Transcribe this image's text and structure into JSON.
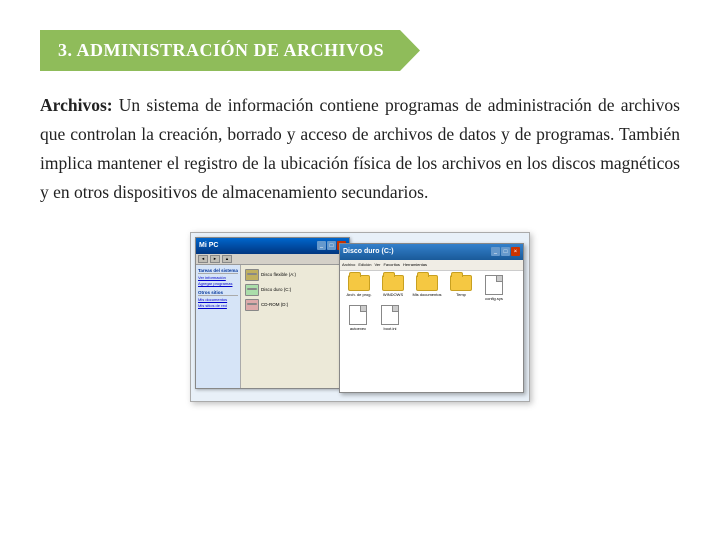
{
  "header": {
    "title": "3.  ADMINISTRACIÓN DE  ARCHIVOS",
    "bg_color": "#8fbc5a"
  },
  "body": {
    "paragraph": {
      "label": "Archivos:",
      "text": "  Un sistema de información contiene programas de administración de archivos que controlan la creación, borrado y acceso de archivos de datos y de programas. También implica mantener el registro de la ubicación física de los archivos en los discos magnéticos y en otros dispositivos de almacenamiento secundarios."
    }
  },
  "screenshot": {
    "left_window": {
      "title": "Mi PC",
      "drives": [
        "Disco flexible (A:)",
        "Disco duro (C:)",
        "CD-ROM (D:)"
      ],
      "sidebar_sections": [
        {
          "title": "Tareas del sistema",
          "items": [
            "Ver información del sistema",
            "Agregar o quitar programas"
          ]
        },
        {
          "title": "Otros sitios",
          "items": [
            "Mis documentos",
            "Mis sitios de red"
          ]
        }
      ]
    },
    "right_window": {
      "title": "Disco duro (C:)",
      "folders": [
        "Archivos de programa",
        "WINDOWS",
        "Mis documentos",
        "Temp"
      ],
      "files": [
        "config",
        "autoexec",
        "boot"
      ]
    }
  }
}
